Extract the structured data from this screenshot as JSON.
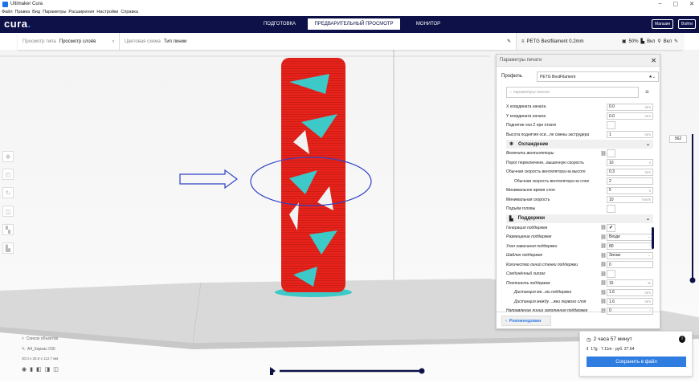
{
  "window": {
    "title": "Ultimaker Cura",
    "controls": [
      "–",
      "▢",
      "✕"
    ]
  },
  "menu": [
    "Файл",
    "Правка",
    "Вид",
    "Параметры",
    "Расширения",
    "Настройки",
    "Справка"
  ],
  "header": {
    "brand": "cura",
    "brand_dot": ".",
    "tabs": [
      "ПОДГОТОВКА",
      "ПРЕДВАРИТЕЛЬНЫЙ ПРОСМОТР",
      "МОНИТОР"
    ],
    "active_tab": 1,
    "marketplace": "Магазин",
    "signin": "Войти"
  },
  "toolbar": {
    "view_type_label": "Просмотр типа",
    "view_type": "Просмотр слоёв",
    "color_scheme_label": "Цветовая схема",
    "color_scheme": "Тип линии",
    "material": "PETG Bestfilament 0.2mm",
    "infill": "50%",
    "support": "Вкл",
    "adhesion": "Вкл"
  },
  "layer_slider": {
    "value": "562"
  },
  "panel": {
    "title": "Параметры печати",
    "profile_label": "Профиль",
    "profile": "PETG BestFilament",
    "search_placeholder": "параметры поиска",
    "rows_top": [
      {
        "label": "X координата начала",
        "value": "0.0",
        "unit": "mm"
      },
      {
        "label": "Y координата начала",
        "value": "0.0",
        "unit": "mm"
      },
      {
        "label": "Поднятие оси Z при откате",
        "check": ""
      },
      {
        "label": "Высота поднятия оси...ле смены экструдера",
        "value": "1",
        "unit": "mm"
      }
    ],
    "cat_cooling": "Охлаждение",
    "rows_cooling": [
      {
        "label": "Включить вентиляторы",
        "check": "",
        "italic": true
      },
      {
        "label": "Порог переключени...вышенную скорость",
        "value": "10",
        "unit": "s"
      },
      {
        "label": "Обычная скорость вентилятора на высоте",
        "value": "0.3",
        "unit": "mm"
      },
      {
        "label": "Обычная скорость вентилятора на слое",
        "value": "2",
        "unit": "",
        "indent": true
      },
      {
        "label": "Минимальное время слоя",
        "value": "5",
        "unit": "s"
      },
      {
        "label": "Минимальная скорость",
        "value": "10",
        "unit": "mm/s"
      },
      {
        "label": "Подъём головы",
        "check": ""
      }
    ],
    "cat_support": "Поддержки",
    "rows_support": [
      {
        "label": "Генерация поддержек",
        "check": "✔",
        "italic": true
      },
      {
        "label": "Размещение поддержек",
        "value": "Везде",
        "unit": "⌄",
        "italic": true
      },
      {
        "label": "Угол нависания поддержки",
        "value": "80",
        "unit": "°",
        "italic": true
      },
      {
        "label": "Шаблон поддержек",
        "value": "Зигзаг",
        "unit": "⌄",
        "italic": true
      },
      {
        "label": "Количество линий стенки поддержки",
        "value": "0",
        "unit": "",
        "italic": true
      },
      {
        "label": "Соединённый зигзаг",
        "check": "",
        "italic": true
      },
      {
        "label": "Плотность поддержек",
        "value": "15",
        "unit": "%",
        "italic": true
      },
      {
        "label": "Дистанция ме...ми поддержки",
        "value": "1.6",
        "unit": "mm",
        "italic": true,
        "indent": true
      },
      {
        "label": "Дистанция между ...жки первого слоя",
        "value": "1.6",
        "unit": "mm",
        "italic": true,
        "indent": true
      },
      {
        "label": "Направление линии заполнения поддержек",
        "value": "0",
        "unit": "°",
        "italic": true
      }
    ],
    "recommended": "Рекомендован"
  },
  "objects": {
    "list_label": "Список объектов",
    "name": "A4_Каркас 030",
    "dims": "30.0 x 26.8 x 112.7 мм"
  },
  "summary": {
    "time": "2 часа 57 минут",
    "material": "17g · 7.11m · руб. 27.64",
    "save": "Сохранить в файл"
  },
  "colors": {
    "header": "#0d1147",
    "accent": "#2f7de1",
    "model": "#e8231b",
    "support": "#3ec9c9"
  }
}
